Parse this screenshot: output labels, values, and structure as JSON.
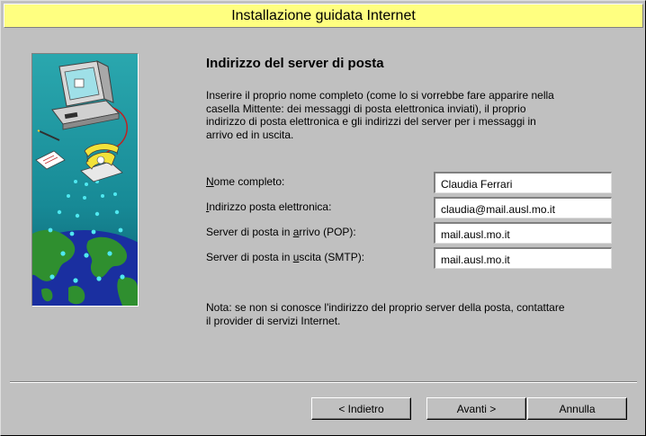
{
  "window": {
    "title": "Installazione guidata Internet"
  },
  "page": {
    "heading": "Indirizzo del server di posta",
    "intro": "Inserire il proprio nome completo (come lo si vorrebbe fare apparire nella casella Mittente: dei messaggi di posta elettronica inviati), il proprio indirizzo di posta elettronica e gli indirizzi del server per i messaggi in arrivo ed in uscita.",
    "note": "Nota: se non si conosce l'indirizzo del proprio server della posta, contattare il provider di servizi Internet."
  },
  "fields": {
    "name": {
      "label_pre": "",
      "label_key": "N",
      "label_post": "ome completo:",
      "value": "Claudia Ferrari"
    },
    "email": {
      "label_pre": "",
      "label_key": "I",
      "label_post": "ndirizzo posta elettronica:",
      "value": "claudia@mail.ausl.mo.it"
    },
    "pop": {
      "label_pre": "Server di posta in ",
      "label_key": "a",
      "label_post": "rrivo (POP):",
      "value": "mail.ausl.mo.it"
    },
    "smtp": {
      "label_pre": "Server di posta in ",
      "label_key": "u",
      "label_post": "scita (SMTP):",
      "value": "mail.ausl.mo.it"
    }
  },
  "buttons": {
    "back": "< Indietro",
    "next": "Avanti >",
    "cancel": "Annulla"
  },
  "colors": {
    "titlebar": "#ffff80",
    "dialog": "#c0c0c0",
    "illustration_sky": "#1f9aa4",
    "earth_land": "#2f8f2f",
    "earth_ocean": "#1a2fa0"
  }
}
